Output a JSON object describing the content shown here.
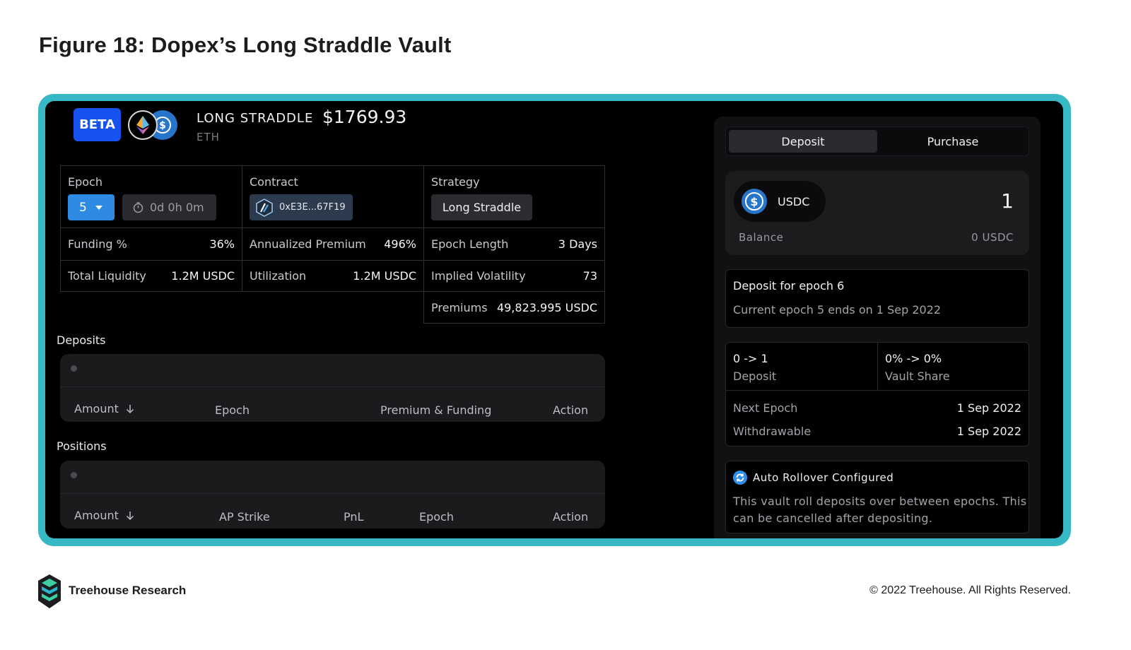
{
  "figure_title": "Figure 18: Dopex’s Long Straddle Vault",
  "header": {
    "beta_badge": "BETA",
    "vault_name": "LONG STRADDLE",
    "price": "$1769.93",
    "asset": "ETH"
  },
  "stats": {
    "epoch_label": "Epoch",
    "epoch_value": "5",
    "timer": "0d 0h 0m",
    "contract_label": "Contract",
    "contract_address": "0xE3E...67F19",
    "strategy_label": "Strategy",
    "strategy_value": "Long Straddle",
    "funding_label": "Funding %",
    "funding_value": "36%",
    "annualized_label": "Annualized Premium",
    "annualized_value": "496%",
    "epoch_length_label": "Epoch Length",
    "epoch_length_value": "3 Days",
    "total_liquidity_label": "Total Liquidity",
    "total_liquidity_value": "1.2M USDC",
    "utilization_label": "Utilization",
    "utilization_value": "1.2M USDC",
    "iv_label": "Implied Volatility",
    "iv_value": "73",
    "premiums_label": "Premiums",
    "premiums_value": "49,823.995 USDC"
  },
  "deposits": {
    "title": "Deposits",
    "columns": [
      "Amount",
      "Epoch",
      "Premium & Funding",
      "Action"
    ]
  },
  "positions": {
    "title": "Positions",
    "columns": [
      "Amount",
      "AP Strike",
      "PnL",
      "Epoch",
      "Action"
    ]
  },
  "sidebar": {
    "tabs": [
      "Deposit",
      "Purchase"
    ],
    "token": "USDC",
    "amount": "1",
    "balance_label": "Balance",
    "balance_value": "0 USDC",
    "deposit_for": "Deposit for epoch 6",
    "epoch_end": "Current epoch 5 ends on 1 Sep 2022",
    "deposit_change": "0 -> 1",
    "deposit_label": "Deposit",
    "share_change": "0% -> 0%",
    "share_label": "Vault Share",
    "next_epoch_label": "Next Epoch",
    "next_epoch_value": "1 Sep 2022",
    "withdrawable_label": "Withdrawable",
    "withdrawable_value": "1 Sep 2022",
    "rollover_title": "Auto Rollover Configured",
    "rollover_desc_1": "This vault roll deposits over between epochs. This",
    "rollover_desc_2": "can be cancelled after depositing."
  },
  "footer": {
    "brand": "Treehouse Research",
    "copyright": "© 2022 Treehouse. All Rights Reserved."
  },
  "colors": {
    "frame": "#36b9c4",
    "beta": "#1652f0",
    "usdc": "#2775ca",
    "epoch_select": "#2d8be3"
  }
}
